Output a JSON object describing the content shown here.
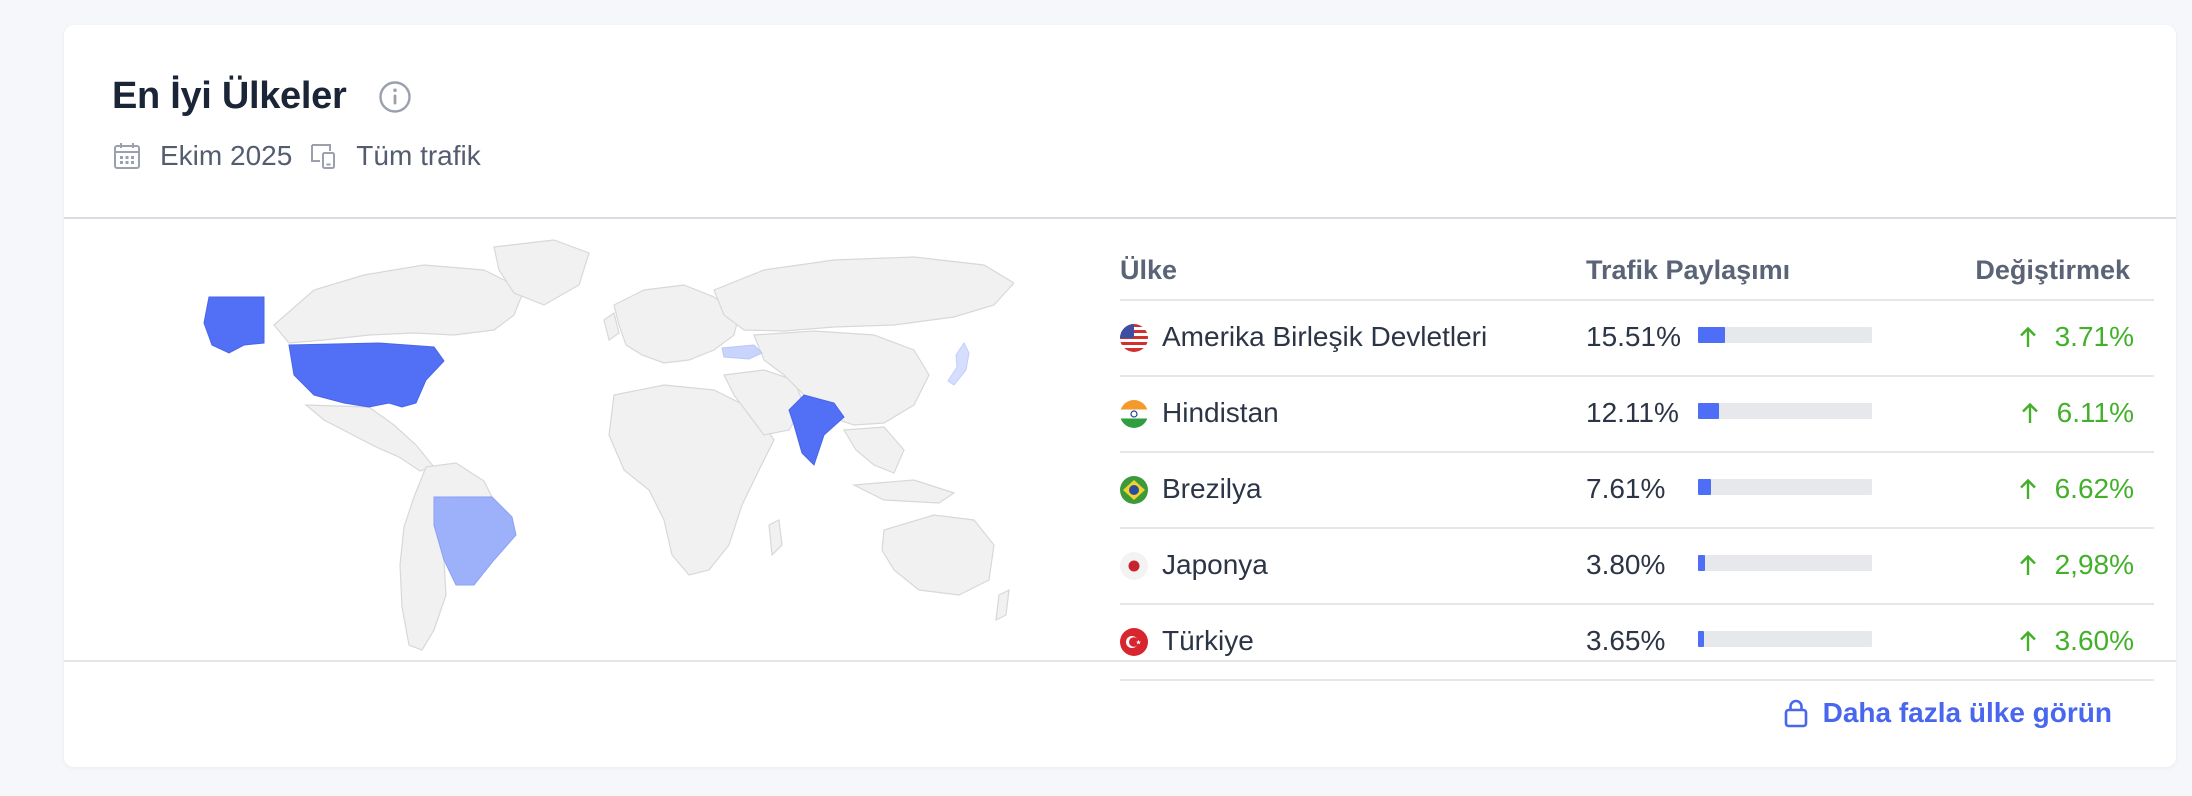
{
  "header": {
    "title": "En İyi Ülkeler",
    "date": "Ekim 2025",
    "traffic": "Tüm trafik"
  },
  "table": {
    "columns": [
      "Ülke",
      "Trafik Paylaşımı",
      "Değiştirmek"
    ],
    "rows": [
      {
        "country": "Amerika Birleşik Devletleri",
        "share": "15.51%",
        "share_value": 15.51,
        "change": "3.71%",
        "flag": "us-flag-icon"
      },
      {
        "country": "Hindistan",
        "share": "12.11%",
        "share_value": 12.11,
        "change": "6.11%",
        "flag": "india-flag-icon"
      },
      {
        "country": "Brezilya",
        "share": "7.61%",
        "share_value": 7.61,
        "change": "6.62%",
        "flag": "brazil-flag-icon"
      },
      {
        "country": "Japonya",
        "share": "3.80%",
        "share_value": 3.8,
        "change": "2,98%",
        "flag": "japan-flag-icon"
      },
      {
        "country": "Türkiye",
        "share": "3.65%",
        "share_value": 3.65,
        "change": "3.60%",
        "flag": "turkey-flag-icon"
      }
    ]
  },
  "footer": {
    "more_label": "Daha fazla ülke görün"
  },
  "colors": {
    "accent": "#4f6ef7",
    "positive": "#43b02a",
    "map_land": "#f1f1f1",
    "map_highlight_strong": "#5270f5",
    "map_highlight_medium": "#9db1fa",
    "map_highlight_light": "#c9d4fc"
  }
}
